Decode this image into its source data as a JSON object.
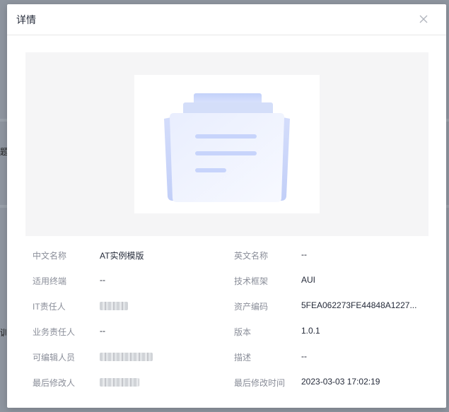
{
  "modal": {
    "title": "详情"
  },
  "details": {
    "rows": [
      {
        "label1": "中文名称",
        "value1": "AT实例模版",
        "label2": "英文名称",
        "value2": "--"
      },
      {
        "label1": "适用终端",
        "value1": "--",
        "label2": "技术框架",
        "value2": "AUI"
      },
      {
        "label1": "IT责任人",
        "value1": "",
        "label2": "资产编码",
        "value2": "5FEA062273FE44848A1227..."
      },
      {
        "label1": "业务责任人",
        "value1": "--",
        "label2": "版本",
        "value2": "1.0.1"
      },
      {
        "label1": "可编辑人员",
        "value1": "",
        "label2": "描述",
        "value2": "--"
      },
      {
        "label1": "最后修改人",
        "value1": "",
        "label2": "最后修改时间",
        "value2": "2023-03-03 17:02:19"
      }
    ]
  },
  "background": {
    "partial_text_1": "题牍",
    "partial_text_2": "训楮"
  },
  "icons": {
    "close": "close-icon",
    "preview": "empty-folder-illustration-icon"
  },
  "colors": {
    "label": "#8a8e99",
    "value": "#252b3a",
    "preview_bg": "#f5f5f6",
    "illustration_blue": "#c9d6fb"
  }
}
